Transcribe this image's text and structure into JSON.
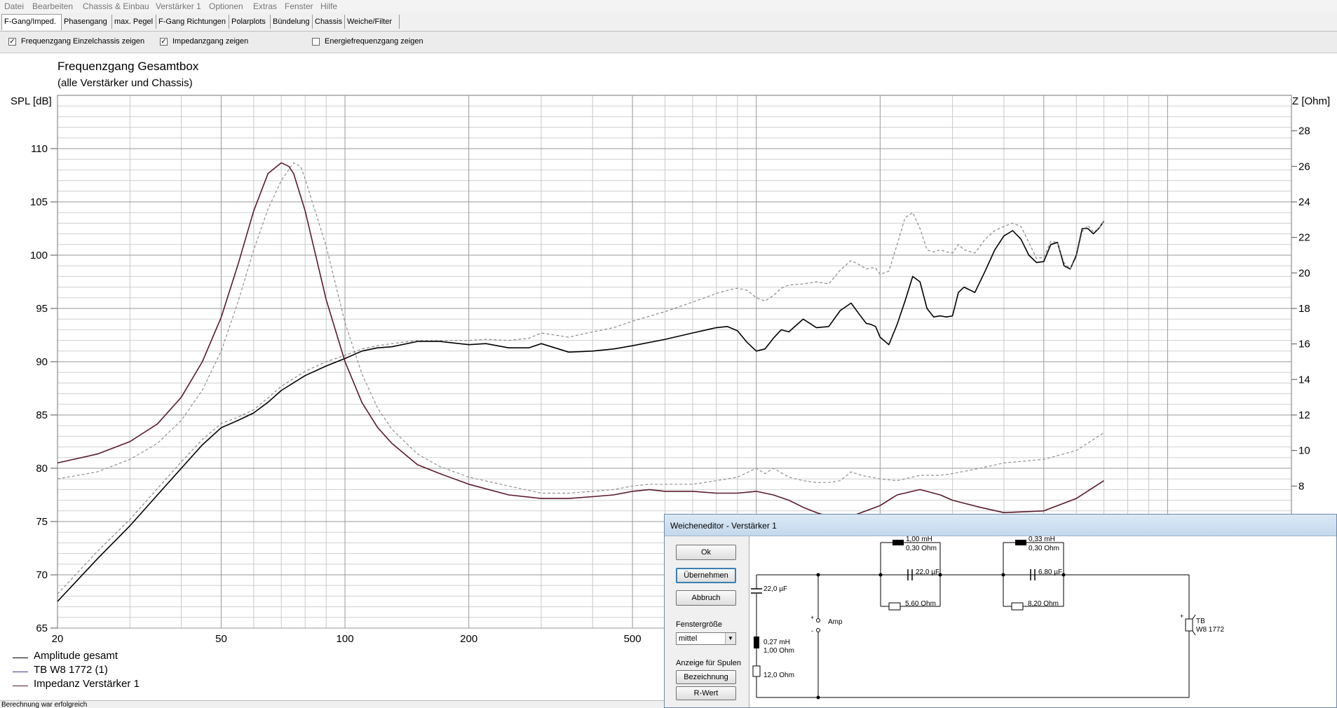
{
  "menu": [
    "Datei",
    "Bearbeiten",
    "Chassis & Einbau",
    "Verstärker 1",
    "Optionen",
    "Extras",
    "Fenster",
    "Hilfe"
  ],
  "tabs": [
    "F-Gang/Imped.",
    "Phasengang",
    "max. Pegel",
    "F-Gang Richtungen",
    "Polarplots",
    "Bündelung",
    "Chassis",
    "Weiche/Filter"
  ],
  "active_tab": "F-Gang/Imped.",
  "options": [
    {
      "label": "Frequenzgang Einzelchassis zeigen",
      "checked": true
    },
    {
      "label": "Impedanzgang zeigen",
      "checked": true
    },
    {
      "label": "Energiefrequenzgang zeigen",
      "checked": false
    }
  ],
  "status": "Berechnung war erfolgreich",
  "chart_data": {
    "type": "line",
    "title": "Frequenzgang Gesamtbox",
    "subtitle": "(alle Verstärker und Chassis)",
    "ylabel": "SPL [dB]",
    "y2label": "Z [Ohm]",
    "xscale": "log",
    "xlim": [
      20,
      20000
    ],
    "ylim": [
      65,
      115
    ],
    "y2lim": [
      0,
      30
    ],
    "xticks": [
      "20",
      "50",
      "100",
      "200",
      "500"
    ],
    "xtick_values": [
      20,
      50,
      100,
      200,
      500
    ],
    "yticks": [
      110,
      105,
      100,
      95,
      90,
      85,
      80,
      75,
      70,
      65
    ],
    "y2ticks": [
      28,
      26,
      24,
      22,
      20,
      18,
      16,
      14,
      12,
      10,
      8
    ],
    "grid": true,
    "legend_position": "bottom-left",
    "series": [
      {
        "name": "Amplitude gesamt",
        "color": "#000000",
        "axis": "y",
        "dash": false,
        "x": [
          20,
          25,
          30,
          35,
          40,
          45,
          50,
          55,
          60,
          65,
          70,
          80,
          90,
          100,
          110,
          120,
          130,
          150,
          170,
          200,
          220,
          250,
          280,
          300,
          350,
          400,
          450,
          500,
          600,
          700,
          800,
          850,
          900,
          950,
          1000,
          1050,
          1100,
          1150,
          1200,
          1300,
          1400,
          1500,
          1600,
          1700,
          1800,
          1850,
          1900,
          1950,
          2000,
          2100,
          2200,
          2300,
          2400,
          2500,
          2600,
          2700,
          2800,
          2900,
          3000,
          3100,
          3200,
          3400,
          3600,
          3800,
          4000,
          4200,
          4400,
          4600,
          4800,
          5000,
          5200,
          5400,
          5600,
          5800,
          6000,
          6200,
          6400,
          6600,
          6800,
          7000
        ],
        "y": [
          67.5,
          71.5,
          74.6,
          77.5,
          80,
          82.2,
          83.8,
          84.5,
          85.2,
          86.2,
          87.3,
          88.7,
          89.6,
          90.3,
          91,
          91.3,
          91.4,
          91.9,
          91.9,
          91.6,
          91.7,
          91.3,
          91.3,
          91.7,
          90.9,
          91,
          91.2,
          91.5,
          92.1,
          92.7,
          93.2,
          93.3,
          92.9,
          91.8,
          91,
          91.2,
          92.2,
          93,
          92.8,
          94,
          93.2,
          93.3,
          94.8,
          95.5,
          94.2,
          93.6,
          93.5,
          93.3,
          92.3,
          91.6,
          93.5,
          95.7,
          98,
          97.5,
          95,
          94.2,
          94.3,
          94.2,
          94.3,
          96.5,
          97,
          96.5,
          98.5,
          100.5,
          101.8,
          102.3,
          101.5,
          100,
          99.3,
          99.4,
          101,
          101.2,
          99,
          98.7,
          100,
          102.5,
          102.5,
          102,
          102.5,
          103.2
        ]
      },
      {
        "name": "TB W8 1772 (1)",
        "color": "#8a8a8a",
        "axis": "y",
        "dash": true,
        "x": [
          20,
          25,
          30,
          35,
          40,
          45,
          50,
          55,
          60,
          65,
          70,
          80,
          90,
          100,
          110,
          120,
          130,
          150,
          170,
          200,
          220,
          250,
          280,
          300,
          350,
          400,
          450,
          500,
          600,
          700,
          800,
          850,
          900,
          950,
          1000,
          1050,
          1100,
          1150,
          1200,
          1300,
          1400,
          1500,
          1600,
          1700,
          1800,
          1850,
          1900,
          1950,
          2000,
          2100,
          2200,
          2300,
          2400,
          2500,
          2600,
          2700,
          2800,
          2900,
          3000,
          3100,
          3200,
          3400,
          3600,
          3800,
          4000,
          4200,
          4400,
          4600,
          4800,
          5000,
          5200,
          5400,
          5600,
          5800,
          6000,
          6200,
          6400,
          6600,
          6800,
          7000
        ],
        "y": [
          68.2,
          72.2,
          75.2,
          78.1,
          80.6,
          82.7,
          84.2,
          84.8,
          85.5,
          86.6,
          87.7,
          89.1,
          90,
          90.6,
          91.2,
          91.5,
          91.7,
          92,
          92,
          92,
          92.1,
          92,
          92.2,
          92.7,
          92.3,
          92.8,
          93.2,
          93.8,
          94.7,
          95.6,
          96.4,
          96.7,
          96.9,
          96.7,
          96,
          95.7,
          96.2,
          96.9,
          97.2,
          97.3,
          97.5,
          97.3,
          98.6,
          99.5,
          99,
          98.7,
          98.8,
          98.8,
          98.2,
          98.5,
          101,
          103.5,
          104,
          102.5,
          100.5,
          100.3,
          100.5,
          100.3,
          100.2,
          101,
          100.5,
          100.2,
          101.5,
          102.3,
          102.7,
          103,
          102.7,
          101.2,
          99.7,
          99.8,
          101.3,
          101.2,
          99.3,
          98.7,
          99.8,
          102.2,
          102.8,
          102.2,
          102.5,
          103.2
        ]
      },
      {
        "name": "Impedanz Verstärker 1",
        "color": "#5a1a2a",
        "axis": "y2",
        "dash": false,
        "x": [
          20,
          25,
          30,
          35,
          40,
          45,
          50,
          55,
          60,
          65,
          70,
          73,
          75,
          80,
          90,
          100,
          110,
          120,
          130,
          150,
          170,
          200,
          250,
          300,
          350,
          400,
          450,
          500,
          550,
          600,
          700,
          800,
          900,
          1000,
          1100,
          1200,
          1300,
          1400,
          1500,
          1700,
          1800,
          2000,
          2200,
          2500,
          2800,
          3000,
          3500,
          4000,
          5000,
          6000,
          7000
        ],
        "y": [
          9.3,
          9.8,
          10.5,
          11.5,
          13,
          15,
          17.5,
          20.5,
          23.5,
          25.6,
          26.2,
          26,
          25.6,
          23.5,
          18.5,
          15,
          12.7,
          11.3,
          10.4,
          9.2,
          8.7,
          8.1,
          7.5,
          7.3,
          7.3,
          7.4,
          7.5,
          7.7,
          7.8,
          7.7,
          7.7,
          7.6,
          7.6,
          7.7,
          7.5,
          7.2,
          6.8,
          6.5,
          6.3,
          6.3,
          6.5,
          6.9,
          7.5,
          7.8,
          7.5,
          7.2,
          6.8,
          6.5,
          6.6,
          7.3,
          8.3
        ]
      },
      {
        "name": "",
        "color": "#909090",
        "axis": "y2",
        "dash": true,
        "x": [
          20,
          25,
          30,
          35,
          40,
          45,
          50,
          55,
          60,
          65,
          70,
          75,
          78,
          80,
          90,
          100,
          110,
          120,
          130,
          150,
          170,
          200,
          250,
          300,
          350,
          400,
          450,
          500,
          550,
          600,
          700,
          800,
          900,
          1000,
          1050,
          1100,
          1200,
          1300,
          1400,
          1500,
          1600,
          1700,
          1800,
          2000,
          2200,
          2500,
          2800,
          3000,
          3500,
          4000,
          5000,
          6000,
          7000
        ],
        "y": [
          8.4,
          8.8,
          9.5,
          10.4,
          11.7,
          13.4,
          15.6,
          18.4,
          21.3,
          23.6,
          25.2,
          26.2,
          26,
          25.3,
          21.5,
          17.2,
          14.3,
          12.4,
          11.2,
          9.8,
          9.1,
          8.5,
          8,
          7.6,
          7.6,
          7.7,
          7.8,
          8,
          8.1,
          8.1,
          8.1,
          8.3,
          8.5,
          9,
          8.7,
          9,
          8.5,
          8.3,
          8.2,
          8.2,
          8.3,
          8.8,
          8.6,
          8.4,
          8.3,
          8.6,
          8.6,
          8.7,
          9,
          9.3,
          9.5,
          10,
          11
        ]
      }
    ]
  },
  "legend": [
    {
      "label": "Amplitude gesamt",
      "color": "#000000"
    },
    {
      "label": "TB W8 1772 (1)",
      "color": "#3a3a8a"
    },
    {
      "label": "Impedanz Verstärker 1",
      "color": "#5a1a2a"
    }
  ],
  "dialog": {
    "title": "Weicheneditor - Verstärker 1",
    "buttons": [
      "Ok",
      "Übernehmen",
      "Abbruch"
    ],
    "window_size_label": "Fenstergröße",
    "window_size_value": "mittel",
    "coil_display_label": "Anzeige für Spulen",
    "coil_buttons": [
      "Bezeichnung",
      "R-Wert"
    ],
    "schematic": {
      "cap_left": "22,0 µF",
      "coil_left_l": "0,27 mH",
      "coil_left_r": "1,00 Ohm",
      "res_left": "12,0 Ohm",
      "amp_label": "Amp",
      "coil1_l": "1,00 mH",
      "coil1_r": "0,30 Ohm",
      "cap1": "22,0 µF",
      "res1": "5,60 Ohm",
      "coil2_l": "0,33 mH",
      "coil2_r": "0,30 Ohm",
      "cap2": "6,80 µF",
      "res2": "8,20 Ohm",
      "driver_name_1": "TB",
      "driver_name_2": "W8 1772"
    }
  }
}
